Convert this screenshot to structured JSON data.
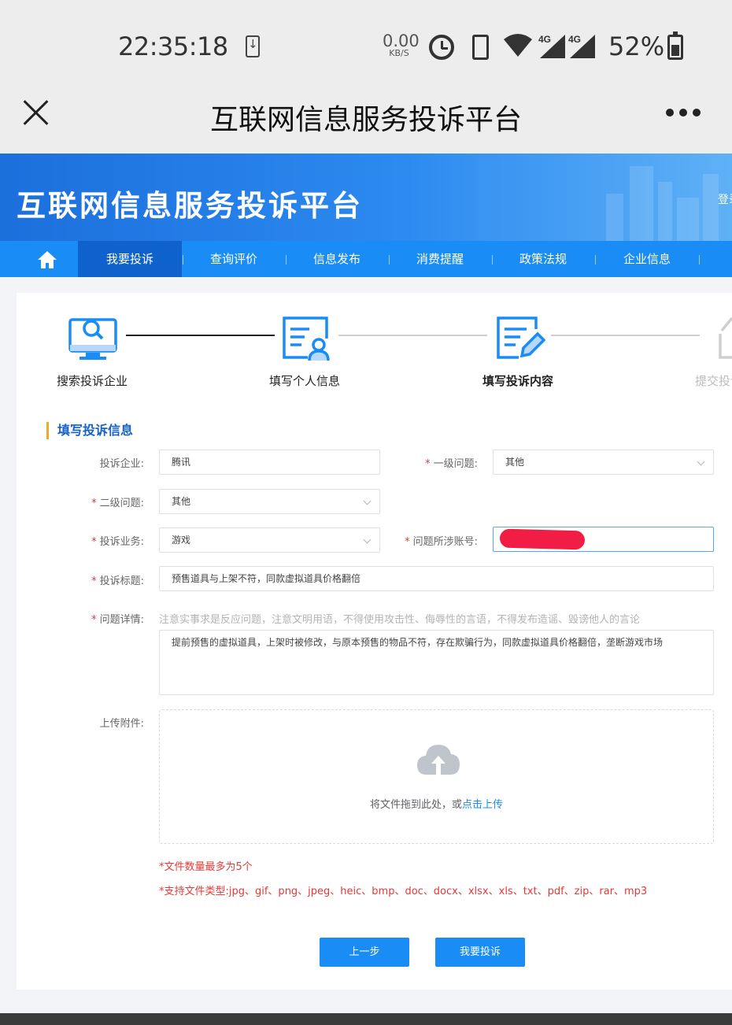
{
  "status_bar": {
    "time": "22:35:18",
    "net_speed_value": "0.00",
    "net_speed_unit": "KB/S",
    "network_1": "4G",
    "network_2": "4G",
    "battery": "52%"
  },
  "titlebar": {
    "title": "互联网信息服务投诉平台"
  },
  "banner": {
    "title": "互联网信息服务投诉平台",
    "login": "登录"
  },
  "nav": {
    "items": [
      {
        "label": "我要投诉"
      },
      {
        "label": "查询评价"
      },
      {
        "label": "信息发布"
      },
      {
        "label": "消费提醒"
      },
      {
        "label": "政策法规"
      },
      {
        "label": "企业信息"
      }
    ]
  },
  "steps": [
    {
      "label": "搜索投诉企业"
    },
    {
      "label": "填写个人信息"
    },
    {
      "label": "填写投诉内容"
    },
    {
      "label": "提交投诉"
    }
  ],
  "form": {
    "section_title": "填写投诉信息",
    "company": {
      "label": "投诉企业:",
      "value": "腾讯"
    },
    "level1": {
      "label": "一级问题:",
      "value": "其他"
    },
    "level2": {
      "label": "二级问题:",
      "value": "其他"
    },
    "business": {
      "label": "投诉业务:",
      "value": "游戏"
    },
    "account": {
      "label": "问题所涉账号:",
      "value": ""
    },
    "subject": {
      "label": "投诉标题:",
      "value": "预售道具与上架不符，同款虚拟道具价格翻倍"
    },
    "details": {
      "label": "问题详情:",
      "hint": "注意实事求是反应问题，注意文明用语，不得使用攻击性、侮辱性的言语，不得发布造谣、毁谤他人的言论",
      "value": "提前预售的虚拟道具，上架时被修改，与原本预售的物品不符，存在欺骗行为，同款虚拟道具价格翻倍，垄断游戏市场"
    },
    "upload": {
      "label": "上传附件:",
      "text": "将文件拖到此处，或",
      "link": "点击上传"
    },
    "note_count": "*文件数量最多为5个",
    "note_types": "*支持文件类型:jpg、gif、png、jpeg、heic、bmp、doc、docx、xlsx、xls、txt、pdf、zip、rar、mp3",
    "prev_button": "上一步",
    "submit_button": "我要投诉"
  }
}
